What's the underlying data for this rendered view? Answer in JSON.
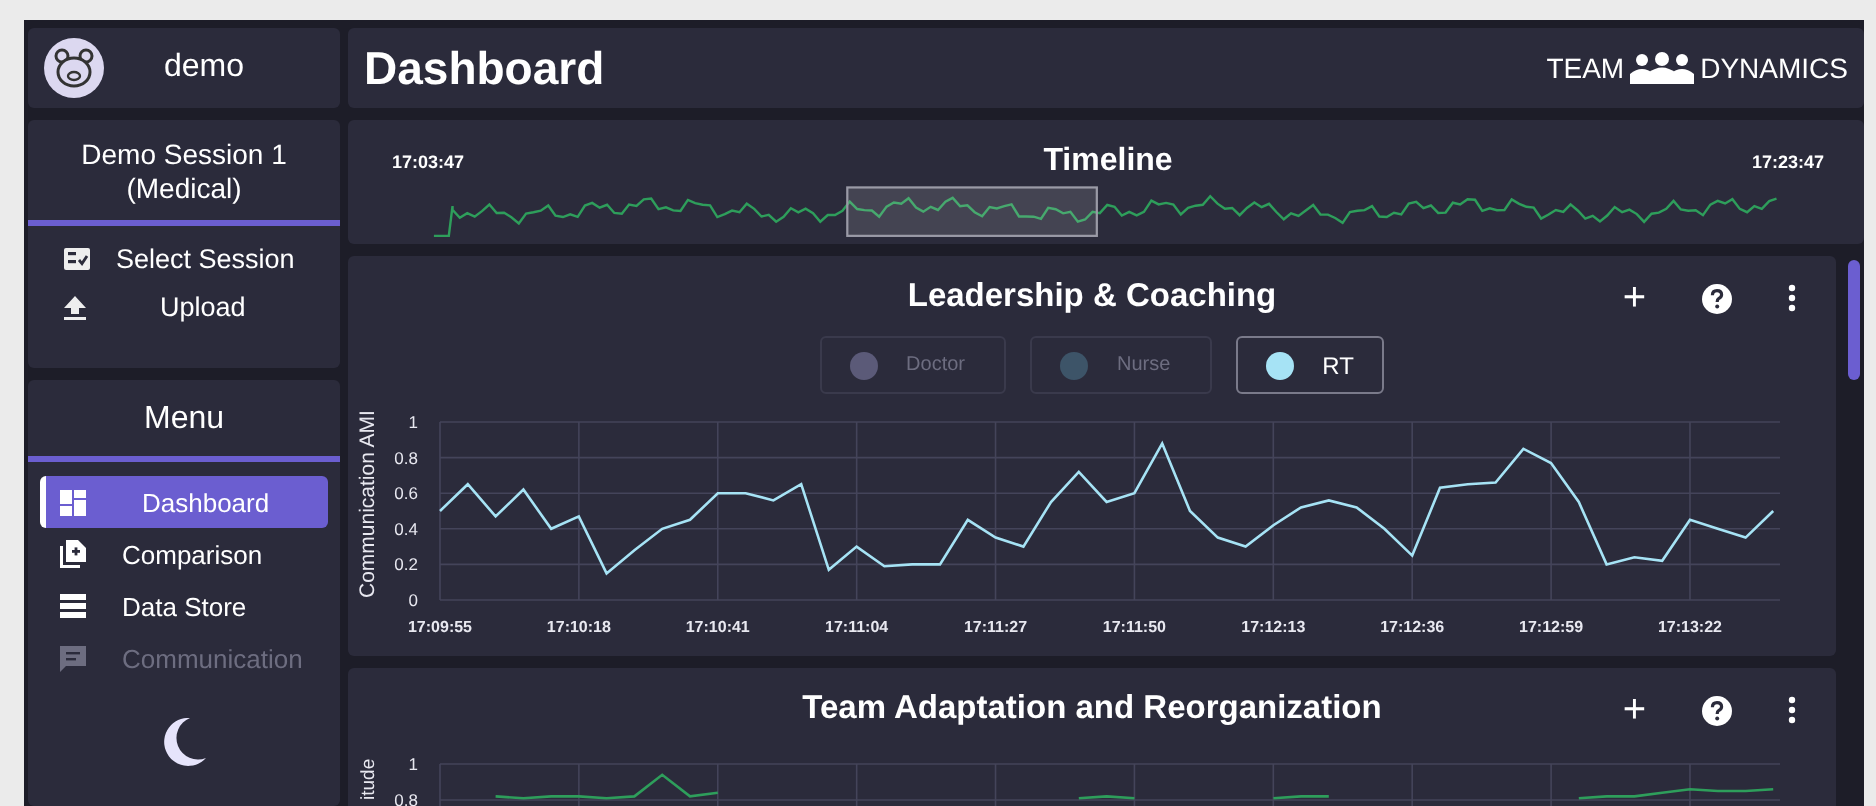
{
  "user": {
    "name": "demo"
  },
  "page_title": "Dashboard",
  "brand": {
    "left": "TEAM",
    "right": "DYNAMICS"
  },
  "session": {
    "name": "Demo Session 1 (Medical)"
  },
  "session_actions": [
    {
      "kind": "select",
      "label": "Select Session"
    },
    {
      "kind": "upload",
      "label": "Upload"
    }
  ],
  "menu": {
    "title": "Menu",
    "items": [
      {
        "kind": "dashboard",
        "label": "Dashboard",
        "selected": true,
        "disabled": false
      },
      {
        "kind": "comparison",
        "label": "Comparison",
        "selected": false,
        "disabled": false
      },
      {
        "kind": "store",
        "label": "Data Store",
        "selected": false,
        "disabled": false
      },
      {
        "kind": "communication",
        "label": "Communication",
        "selected": false,
        "disabled": true
      }
    ]
  },
  "timeline": {
    "title": "Timeline",
    "start": "17:03:47",
    "end": "17:23:47"
  },
  "panels": [
    {
      "title": "Leadership & Coaching",
      "actions": [
        "+"
      ],
      "legend": [
        {
          "label": "Doctor",
          "color": "#5b5a78",
          "selected": false
        },
        {
          "label": "Nurse",
          "color": "#3d5468",
          "selected": false
        },
        {
          "label": "RT",
          "color": "#a6e3f5",
          "selected": true
        }
      ],
      "chart_data": {
        "type": "line",
        "ylabel": "Communication AMI",
        "ylim": [
          0,
          1
        ],
        "grid": true,
        "yticks": [
          0,
          0.2,
          0.4,
          0.6,
          0.8,
          1
        ],
        "categories": [
          "17:09:55",
          null,
          null,
          null,
          null,
          "17:10:18",
          null,
          null,
          null,
          null,
          "17:10:41",
          null,
          null,
          null,
          null,
          "17:11:04",
          null,
          null,
          null,
          null,
          "17:11:27",
          null,
          null,
          null,
          null,
          "17:11:50",
          null,
          null,
          null,
          null,
          "17:12:13",
          null,
          null,
          null,
          null,
          "17:12:36",
          null,
          null,
          null,
          null,
          "17:12:59",
          null,
          null,
          null,
          null,
          "17:13:22",
          null,
          null,
          null
        ],
        "series": [
          {
            "color": "#a6e3f5",
            "values": [
              0.5,
              0.65,
              0.47,
              0.62,
              0.4,
              0.47,
              0.15,
              0.28,
              0.4,
              0.45,
              0.6,
              0.6,
              0.56,
              0.65,
              0.17,
              0.3,
              0.19,
              0.2,
              0.2,
              0.45,
              0.35,
              0.3,
              0.55,
              0.72,
              0.55,
              0.6,
              0.88,
              0.5,
              0.35,
              0.3,
              0.42,
              0.52,
              0.56,
              0.52,
              0.4,
              0.25,
              0.63,
              0.65,
              0.66,
              0.85,
              0.77,
              0.55,
              0.2,
              0.24,
              0.22,
              0.45,
              0.4,
              0.35,
              0.5
            ]
          }
        ]
      }
    },
    {
      "title": "Team Adaptation and Reorganization",
      "actions": [
        "+"
      ],
      "chart_data": {
        "type": "line",
        "ylabel": "itude",
        "ylim": [
          0,
          1
        ],
        "yticks": [
          0.8,
          1
        ],
        "grid": true,
        "series": [
          {
            "color": "#2e9e5b",
            "values": [
              null,
              null,
              0.82,
              0.81,
              0.82,
              0.82,
              0.81,
              0.82,
              0.94,
              0.82,
              0.84,
              null,
              null,
              null,
              null,
              null,
              null,
              null,
              null,
              null,
              null,
              null,
              null,
              0.81,
              0.82,
              0.81,
              null,
              null,
              null,
              null,
              0.81,
              0.82,
              0.82,
              null,
              null,
              null,
              null,
              null,
              null,
              null,
              null,
              0.81,
              0.82,
              0.82,
              0.84,
              0.86,
              0.85,
              0.85,
              0.86
            ]
          }
        ]
      }
    }
  ]
}
